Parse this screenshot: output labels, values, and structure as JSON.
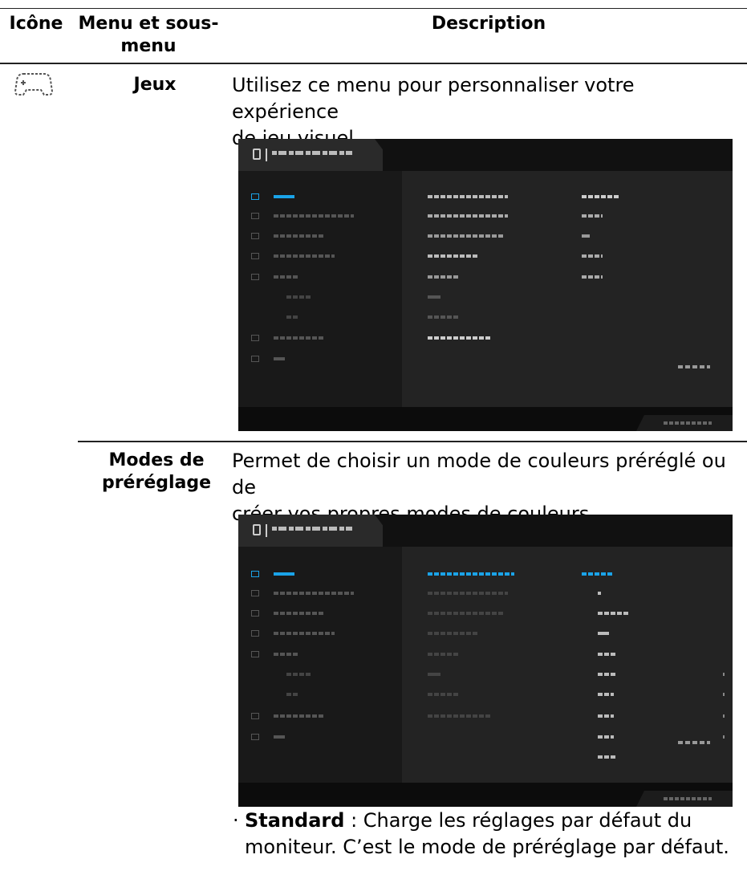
{
  "table": {
    "headers": {
      "icon": "Icône",
      "menu": "Menu et sous-",
      "menu2": "menu",
      "description": "Description"
    }
  },
  "rows": [
    {
      "menu_label": "Jeux",
      "description_line1": "Utilisez ce menu pour personnaliser votre expérience",
      "description_line2": "de jeu visuel.",
      "icon": "gamepad-icon"
    },
    {
      "menu_label_line1": "Modes de",
      "menu_label_line2": "préréglage",
      "description_line1": "Permet de choisir un mode de couleurs préréglé ou de",
      "description_line2": "créer vos propres modes de couleurs."
    }
  ],
  "bullets": [
    {
      "term": "Standard",
      "sep": " : ",
      "text_line1": "Charge les réglages par défaut du",
      "text_line2": "moniteur. C’est le mode de préréglage par défaut."
    }
  ],
  "colors": {
    "osd_highlight": "#1aa3e8",
    "osd_bg": "#1d1d1d",
    "text": "#000000"
  }
}
